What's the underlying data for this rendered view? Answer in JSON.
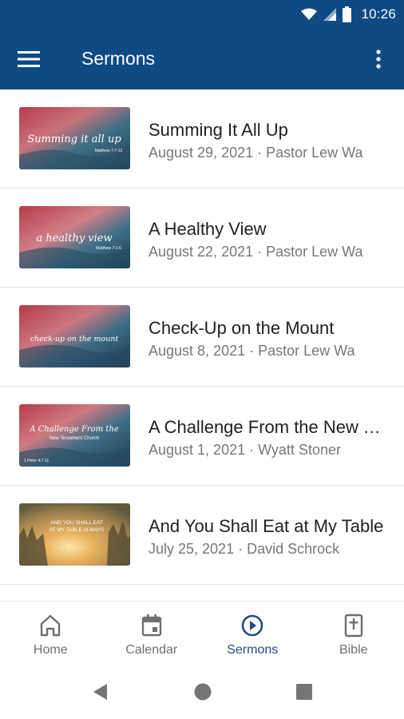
{
  "status_bar": {
    "time": "10:26",
    "icons": [
      "wifi-icon",
      "signal-icon",
      "battery-icon"
    ]
  },
  "app_bar": {
    "title": "Sermons",
    "menu_icon": "hamburger-menu-icon",
    "more_icon": "more-vert-icon",
    "color": "#0f4a85"
  },
  "sermons": [
    {
      "title": "Summing It All Up",
      "meta": "August 29, 2021 · Pastor Lew Wa",
      "thumb_text": "Summing it all up",
      "thumb_ref": "Matthew 7:7-12"
    },
    {
      "title": "A Healthy View",
      "meta": "August 22, 2021 · Pastor Lew Wa",
      "thumb_text": "a healthy view",
      "thumb_ref": "Matthew 7:1-6"
    },
    {
      "title": "Check-Up on the Mount",
      "meta": "August 8, 2021 · Pastor Lew Wa",
      "thumb_text": "check-up on the mount",
      "thumb_ref": ""
    },
    {
      "title": "A Challenge From the New Testament Church",
      "meta": "August 1, 2021 · Wyatt Stoner",
      "thumb_text": "A Challenge From the",
      "thumb_text2": "New Testament Church",
      "thumb_ref": "1 Peter 4:7-11"
    },
    {
      "title": "And You Shall Eat at My Table",
      "meta": "July 25, 2021 · David Schrock",
      "thumb_text": "AND YOU SHALL EAT",
      "thumb_text2": "AT MY TABLE ALWAYS",
      "thumb_ref": ""
    }
  ],
  "bottom_nav": [
    {
      "label": "Home",
      "icon": "home-icon",
      "active": false
    },
    {
      "label": "Calendar",
      "icon": "calendar-icon",
      "active": false
    },
    {
      "label": "Sermons",
      "icon": "play-circle-icon",
      "active": true
    },
    {
      "label": "Bible",
      "icon": "bible-icon",
      "active": false
    }
  ],
  "system_nav": [
    "back-icon",
    "home-circle-icon",
    "recents-icon"
  ],
  "colors": {
    "primary": "#0f4a85",
    "active_nav": "#1f4b85",
    "inactive_nav": "#6f6f6f"
  }
}
